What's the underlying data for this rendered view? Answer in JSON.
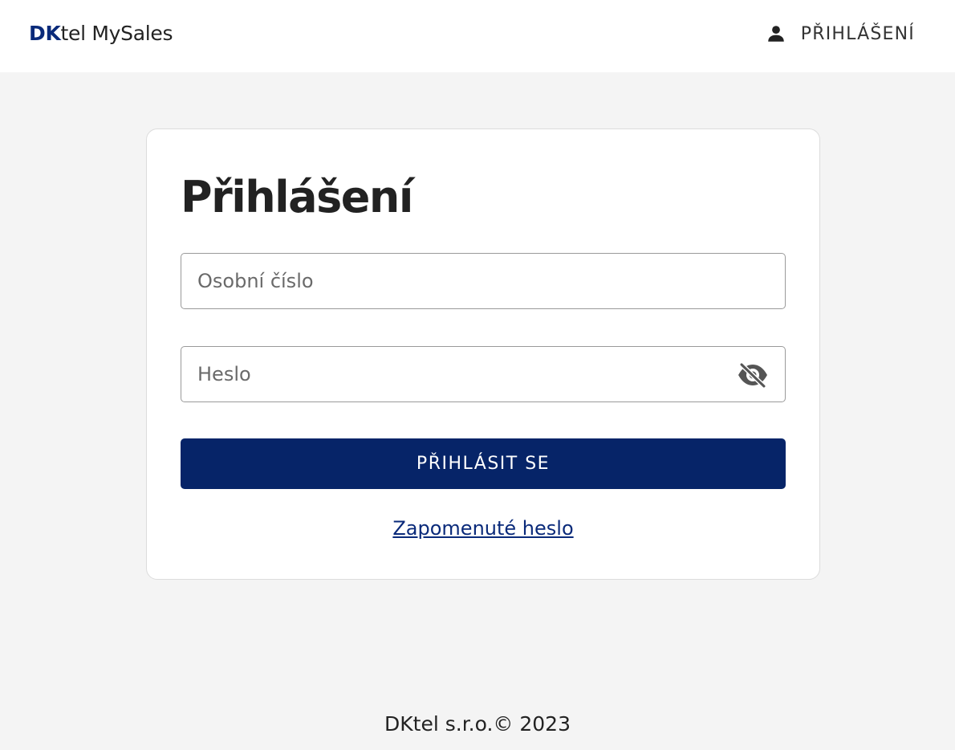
{
  "header": {
    "brand_prefix": "DK",
    "brand_suffix": "tel MySales",
    "login_label": "PŘIHLÁŠENÍ",
    "login_icon": "person-icon"
  },
  "login_form": {
    "title": "Přihlášení",
    "username": {
      "placeholder": "Osobní číslo",
      "value": ""
    },
    "password": {
      "placeholder": "Heslo",
      "value": "",
      "toggle_icon": "eye-off-icon"
    },
    "submit_label": "PŘIHLÁSIT SE",
    "forgot_label": "Zapomenuté heslo"
  },
  "footer": {
    "copyright": "DKtel s.r.o.© 2023"
  },
  "colors": {
    "brand": "#0a2a7a",
    "primary_button": "#062468",
    "page_background": "#f4f4f4",
    "header_background": "#ffffff"
  }
}
